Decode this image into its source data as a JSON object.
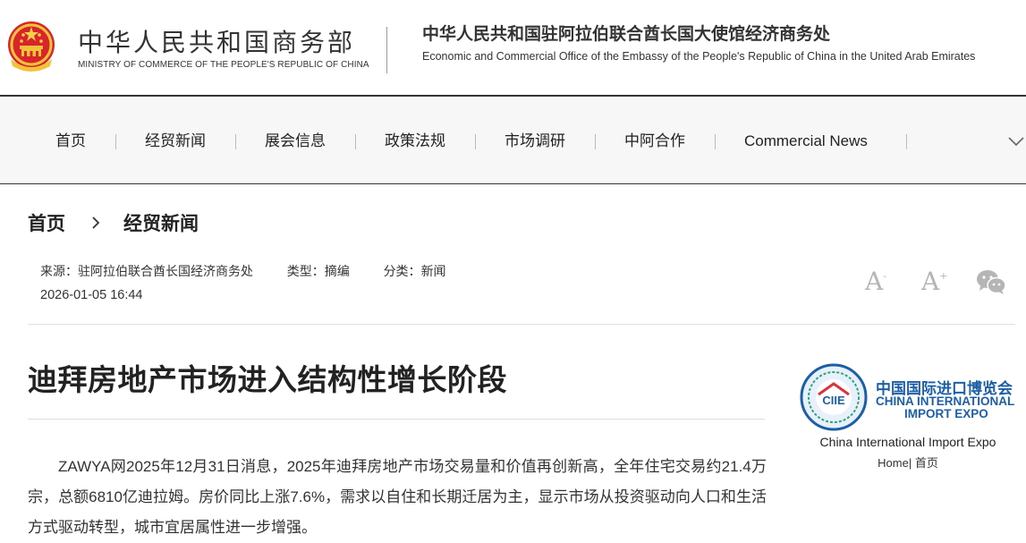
{
  "header": {
    "ministry_cn": "中华人民共和国商务部",
    "ministry_en": "MINISTRY OF COMMERCE OF THE PEOPLE'S REPUBLIC OF CHINA",
    "office_cn": "中华人民共和国驻阿拉伯联合酋长国大使馆经济商务处",
    "office_en": "Economic and Commercial Office of the Embassy of the People's Republic of China in the United Arab Emirates",
    "emblem_icon": "national-emblem-icon"
  },
  "nav": {
    "items": [
      {
        "label": "首页"
      },
      {
        "label": "经贸新闻"
      },
      {
        "label": "展会信息"
      },
      {
        "label": "政策法规"
      },
      {
        "label": "市场调研"
      },
      {
        "label": "中阿合作"
      },
      {
        "label": "Commercial News"
      }
    ],
    "more_icon": "chevron-down-icon"
  },
  "breadcrumb": {
    "home": "首页",
    "current": "经贸新闻"
  },
  "meta": {
    "source_label": "来源：",
    "source": "驻阿拉伯联合酋长国经济商务处",
    "type_label": "类型：",
    "type": "摘编",
    "category_label": "分类：",
    "category": "新闻",
    "date": "2026-01-05 16:44"
  },
  "tools": {
    "font_smaller": "A",
    "font_larger": "A",
    "font_larger_sup": "+",
    "font_smaller_sup": "-",
    "share_icon": "wechat-icon"
  },
  "article": {
    "title": "迪拜房地产市场进入结构性增长阶段",
    "paragraph": "ZAWYA网2025年12月31日消息，2025年迪拜房地产市场交易量和价值再创新高，全年住宅交易约21.4万宗，总额6810亿迪拉姆。房价同比上涨7.6%，需求以自住和长期迁居为主，显示市场从投资驱动向人口和生活方式驱动转型，城市宜居属性进一步增强。"
  },
  "sidebar": {
    "ciie_cn": "中国国际进口博览会",
    "ciie_en_line1": "CHINA INTERNATIONAL",
    "ciie_en_line2": "IMPORT EXPO",
    "ciie_logo_text": "CIIE",
    "caption": "China International Import Expo",
    "home_en": "Home",
    "home_sep": "|",
    "home_cn": "首页",
    "brand_blue": "#1c5fa8"
  }
}
